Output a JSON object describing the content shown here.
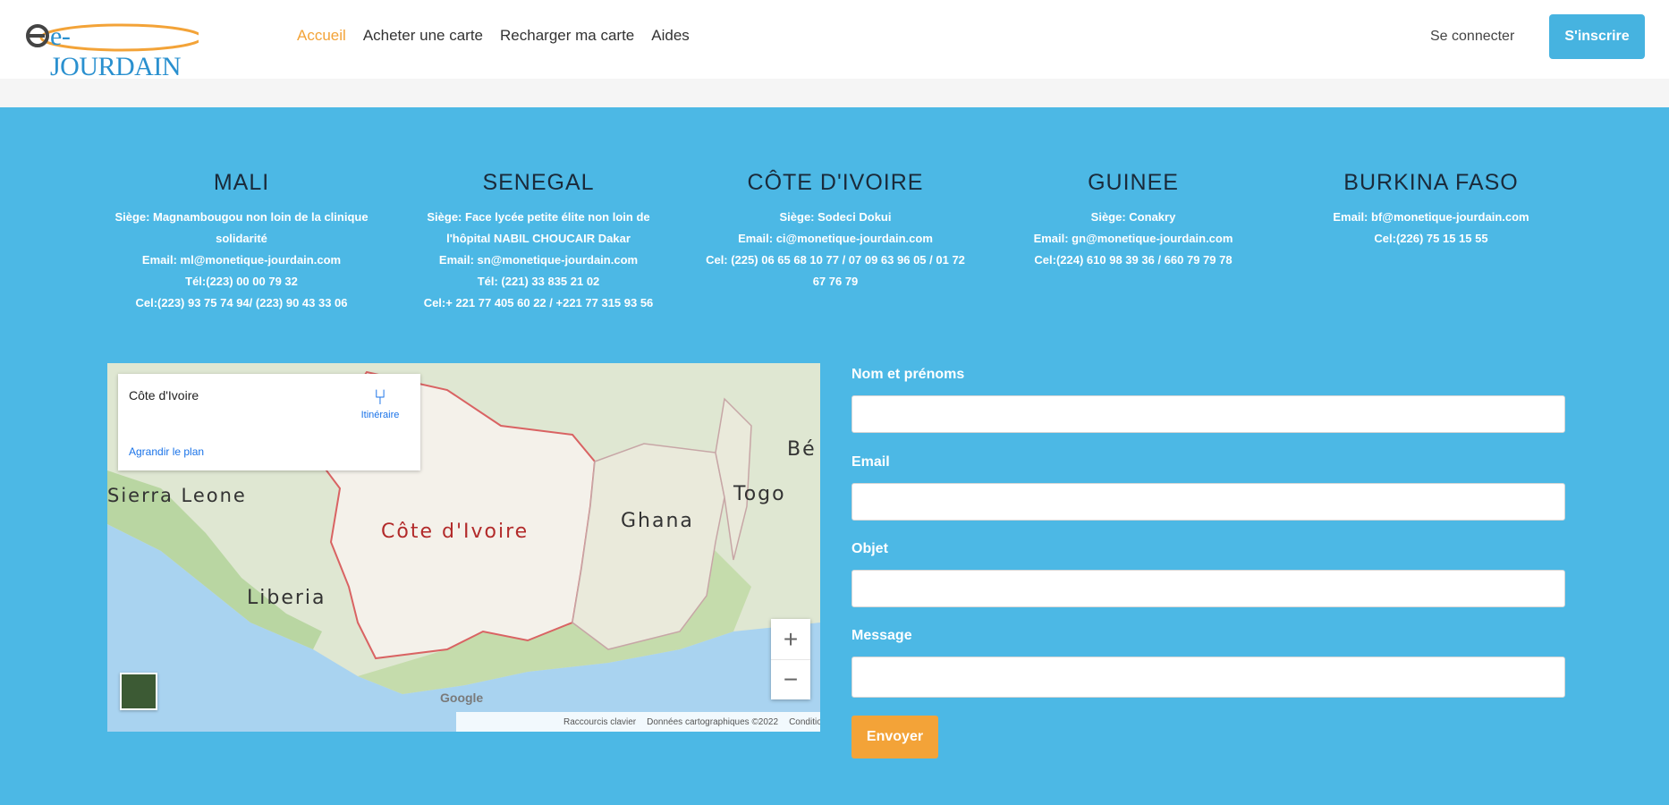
{
  "header": {
    "logo": "e-JOURDAIN",
    "nav": [
      "Accueil",
      "Acheter une carte",
      "Recharger ma carte",
      "Aides"
    ],
    "login": "Se connecter",
    "signup": "S'inscrire"
  },
  "offices": [
    {
      "country": "MALI",
      "lines": [
        "Siège: Magnambougou non loin de la clinique solidarité",
        "Email: ml@monetique-jourdain.com",
        "Tél:(223) 00 00 79 32",
        "Cel:(223) 93 75 74 94/ (223) 90 43 33 06"
      ]
    },
    {
      "country": "SENEGAL",
      "lines": [
        "Siège: Face lycée petite élite non loin de l'hôpital NABIL CHOUCAIR Dakar",
        "Email: sn@monetique-jourdain.com",
        "Tél: (221) 33 835 21 02",
        "Cel:+ 221 77 405 60 22 / +221 77 315 93 56"
      ]
    },
    {
      "country": "CÔTE D'IVOIRE",
      "lines": [
        "Siège: Sodeci Dokui",
        "Email: ci@monetique-jourdain.com",
        "Cel: (225) 06 65 68 10 77 / 07 09 63 96 05 / 01 72 67 76 79"
      ]
    },
    {
      "country": "GUINEE",
      "lines": [
        "Siège: Conakry",
        "Email: gn@monetique-jourdain.com",
        "Cel:(224) 610 98 39 36 / 660 79 79 78"
      ]
    },
    {
      "country": "BURKINA FASO",
      "lines": [
        "Email: bf@monetique-jourdain.com",
        "Cel:(226) 75 15 15 55"
      ]
    }
  ],
  "map": {
    "place": "Côte d'Ivoire",
    "directions": "Itinéraire",
    "enlarge": "Agrandir le plan",
    "labels": {
      "sierra_leone": "Sierra Leone",
      "liberia": "Liberia",
      "cote_divoire": "Côte d'Ivoire",
      "ghana": "Ghana",
      "togo": "Togo",
      "benin": "Bé"
    },
    "zoom_in": "+",
    "zoom_out": "−",
    "google": "Google",
    "footer": [
      "Raccourcis clavier",
      "Données cartographiques ©2022",
      "Conditions d'utilisation"
    ]
  },
  "form": {
    "name_label": "Nom et prénoms",
    "email_label": "Email",
    "subject_label": "Objet",
    "message_label": "Message",
    "send": "Envoyer"
  },
  "colors": {
    "primary": "#4cb8e5",
    "accent": "#f3a338"
  }
}
